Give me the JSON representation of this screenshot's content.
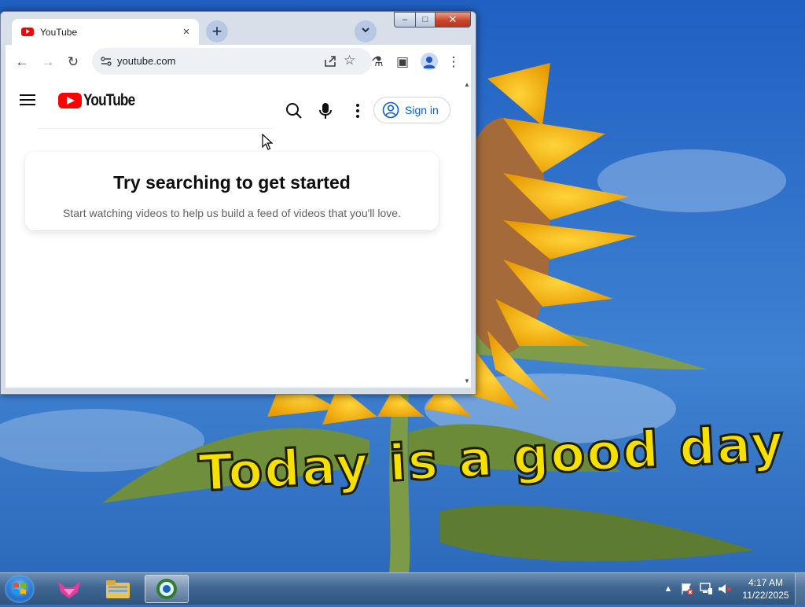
{
  "desktop": {
    "wallpaper_caption": "Today is a good day"
  },
  "browser": {
    "window_controls": {
      "minimize": "–",
      "maximize": "□",
      "close": "✕"
    },
    "tab": {
      "title": "YouTube",
      "close": "×"
    },
    "new_tab": "+",
    "tab_search": "⌄",
    "toolbar": {
      "back_icon": "←",
      "forward_icon": "→",
      "reload_icon": "↻",
      "url": "youtube.com",
      "star_icon": "☆",
      "labs_icon": "⚗",
      "side_panel_icon": "▣",
      "menu_icon": "⋮"
    }
  },
  "youtube": {
    "logo_text": "YouTube",
    "sign_in_label": "Sign in",
    "prompt_title": "Try searching to get started",
    "prompt_body": "Start watching videos to help us build a feed of videos that you'll love."
  },
  "taskbar": {
    "clock_time": "4:17 AM",
    "clock_date": "11/22/2025",
    "tray_expand": "▲"
  },
  "colors": {
    "youtube_red": "#ff0000",
    "link_blue": "#065fd4",
    "sky_blue": "#2f6fc4",
    "sunflower_yellow": "#f5b800",
    "caption_yellow": "#f5e000"
  }
}
